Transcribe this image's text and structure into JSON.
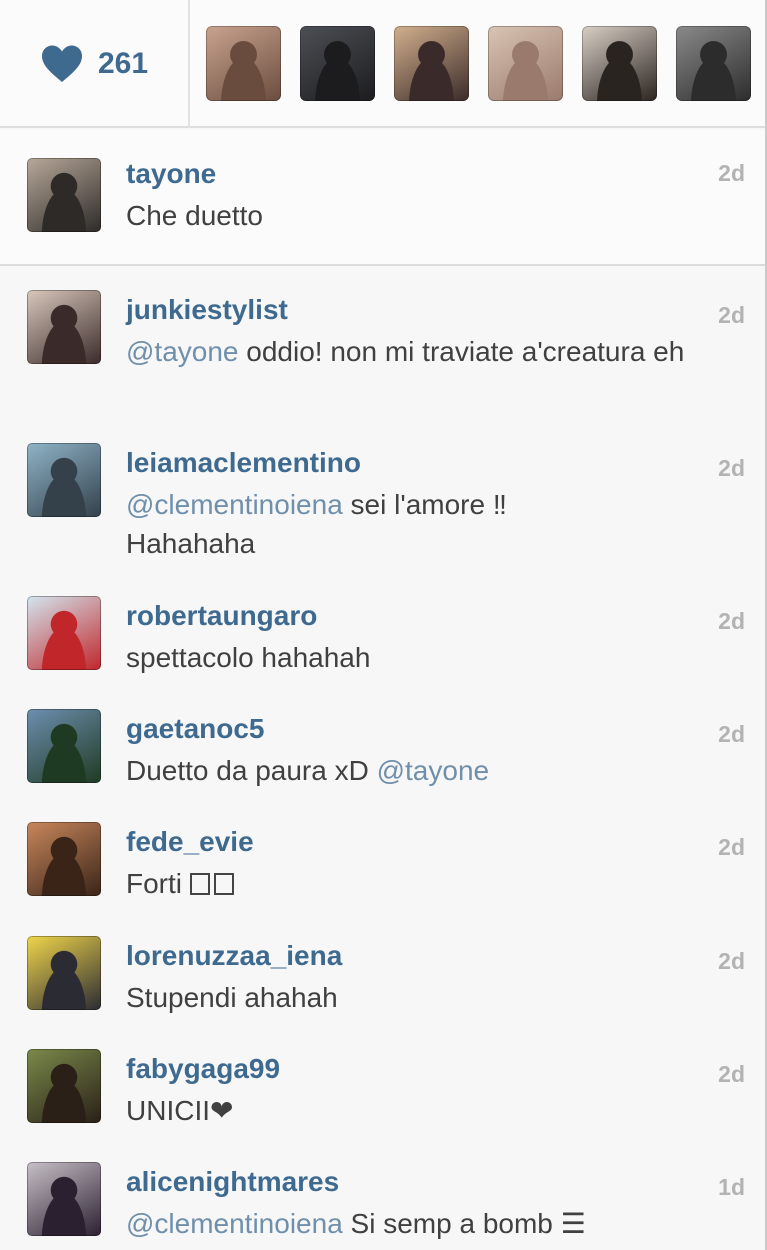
{
  "likes": {
    "count": "261",
    "avatar_colors": [
      [
        "#c9a48f",
        "#6a4c3e"
      ],
      [
        "#4c4f55",
        "#1c1c1e"
      ],
      [
        "#d2b08d",
        "#3a2b2a"
      ],
      [
        "#d9c4b3",
        "#9a7a6d"
      ],
      [
        "#d9cfc6",
        "#2a2420"
      ],
      [
        "#8a8a8a",
        "#2c2c2c"
      ]
    ]
  },
  "caption": {
    "username": "tayone",
    "text": "Che duetto",
    "time": "2d",
    "avatar_colors": [
      "#b8a99a",
      "#2d2a28"
    ]
  },
  "comments": [
    {
      "username": "junkiestylist",
      "mention": "@tayone",
      "text": " oddio! non mi traviate a'creatura eh",
      "time": "2d",
      "avatar_colors": [
        "#d8c8bc",
        "#3b2a2a"
      ]
    },
    {
      "username": "leiamaclementino",
      "mention": "@clementinoiena",
      "text": " sei l'amore ‼ Hahahaha",
      "time": "2d",
      "avatar_colors": [
        "#8fb4c8",
        "#34404a"
      ]
    },
    {
      "username": "robertaungaro",
      "mention": "",
      "text": "spettacolo hahahah",
      "time": "2d",
      "avatar_colors": [
        "#d3e6ef",
        "#c0262a"
      ]
    },
    {
      "username": "gaetanoc5",
      "mention": "",
      "text": "Duetto da paura xD ",
      "trailing_mention": "@tayone",
      "time": "2d",
      "avatar_colors": [
        "#6d8fb0",
        "#1f3a22"
      ]
    },
    {
      "username": "fede_evie",
      "mention": "",
      "text": "Forti ",
      "time": "2d",
      "avatar_colors": [
        "#c9875c",
        "#3a2418"
      ]
    },
    {
      "username": "lorenuzzaa_iena",
      "mention": "",
      "text": "Stupendi ahahah",
      "time": "2d",
      "avatar_colors": [
        "#f0d64a",
        "#2b2b33"
      ]
    },
    {
      "username": "fabygaga99",
      "mention": "",
      "text": "UNICII❤",
      "time": "2d",
      "avatar_colors": [
        "#7a8a4a",
        "#2a2018"
      ]
    },
    {
      "username": "alicenightmares",
      "mention": "@clementinoiena",
      "text": " Si semp a bomb ☰",
      "time": "1d",
      "avatar_colors": [
        "#c8c0c8",
        "#2a2030"
      ]
    }
  ]
}
